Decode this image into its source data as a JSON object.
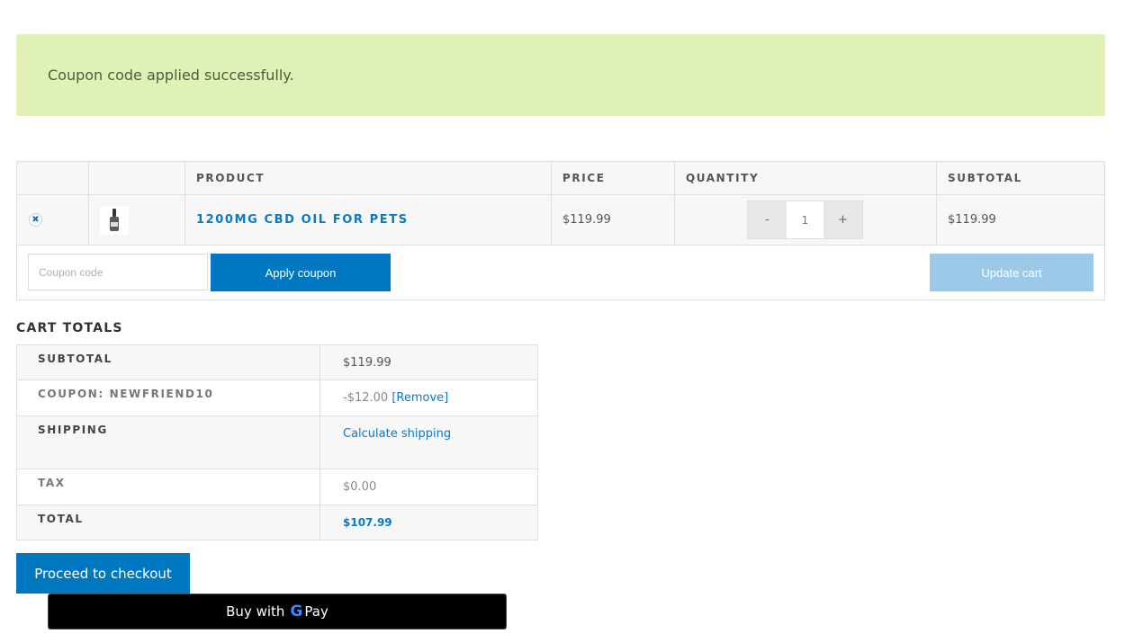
{
  "notice": {
    "message": "Coupon code applied successfully.",
    "color": "#e0f1b5"
  },
  "cart": {
    "headers": {
      "product": "Product",
      "price": "Price",
      "quantity": "Quantity",
      "subtotal": "Subtotal"
    },
    "items": [
      {
        "name": "1200MG CBD OIL FOR PETS",
        "price": "$119.99",
        "quantity": "1",
        "subtotal": "$119.99",
        "remove_icon": "close-icon",
        "thumbnail_icon": "dropper-bottle-icon"
      }
    ],
    "qty_minus": "-",
    "qty_plus": "+",
    "coupon_placeholder": "Coupon code",
    "apply_coupon_label": "Apply coupon",
    "update_cart_label": "Update cart"
  },
  "totals": {
    "title": "CART TOTALS",
    "subtotal_label": "Subtotal",
    "subtotal_value": "$119.99",
    "coupon_label": "Coupon: newfriend10",
    "coupon_value": "-$12.00",
    "coupon_remove": "[Remove]",
    "shipping_label": "Shipping",
    "shipping_link": "Calculate shipping",
    "tax_label": "Tax",
    "tax_value": "$0.00",
    "total_label": "Total",
    "total_value": "$107.99"
  },
  "checkout_label": "Proceed to checkout",
  "gpay": {
    "prefix": "Buy with",
    "g": "G",
    "pay": "Pay"
  },
  "colors": {
    "accent": "#0078c1",
    "link": "#0a7ac4",
    "update_disabled": "#9cc9e8"
  }
}
